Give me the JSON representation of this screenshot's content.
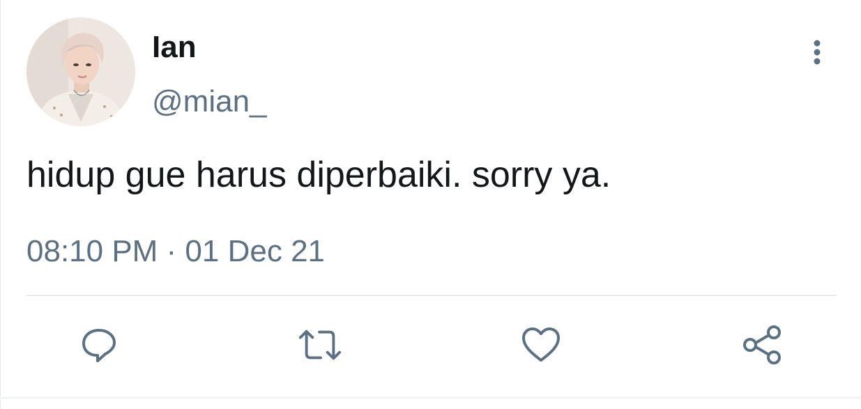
{
  "tweet": {
    "author": {
      "display_name": "Ian",
      "handle": "@mian_"
    },
    "text": "hidup gue harus diperbaiki. sorry ya.",
    "timestamp": "08:10 PM · 01 Dec 21"
  },
  "icons": {
    "more": "more-vertical-icon",
    "reply": "reply-icon",
    "retweet": "retweet-icon",
    "like": "heart-icon",
    "share": "share-icon"
  },
  "colors": {
    "text_primary": "#14171a",
    "text_secondary": "#5b7083",
    "divider": "#e6ecf0"
  }
}
